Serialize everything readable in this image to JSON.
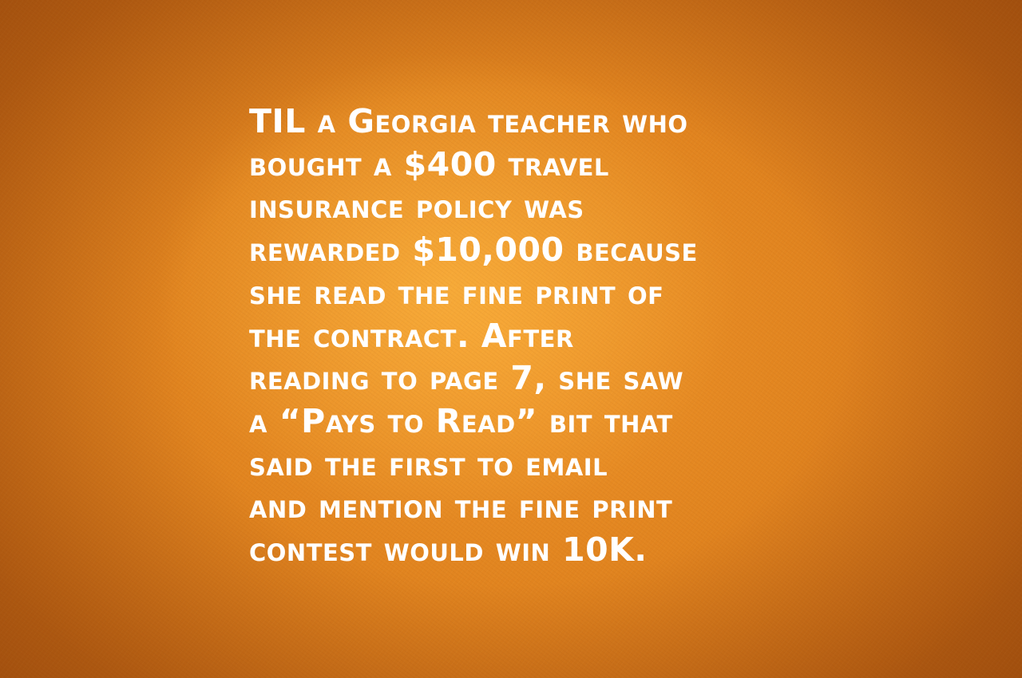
{
  "fact": {
    "lines": [
      "TIL a Georgia teacher who",
      "bought a $400 travel",
      "insurance policy was",
      "rewarded $10,000 because",
      "she read the fine print of",
      "the contract. After",
      "reading to page 7, she saw",
      "a “Pays to Read” bit that",
      "said the first to email",
      "and mention the fine print",
      "contest would win 10K."
    ]
  },
  "colors": {
    "background": "#e1841f",
    "text": "#ffffff"
  }
}
